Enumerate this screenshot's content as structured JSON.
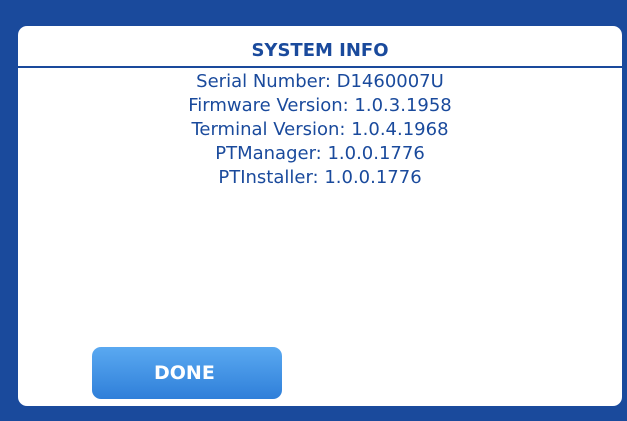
{
  "dialog": {
    "title": "SYSTEM INFO",
    "info": [
      "Serial Number: D1460007U",
      "Firmware Version: 1.0.3.1958",
      "Terminal Version: 1.0.4.1968",
      "PTManager: 1.0.0.1776",
      "PTInstaller: 1.0.0.1776"
    ],
    "done_label": "DONE"
  },
  "colors": {
    "frame": "#1a4a9c",
    "text": "#1a4a9c",
    "button_top": "#5aa9f1",
    "button_bottom": "#2f7fd9"
  }
}
